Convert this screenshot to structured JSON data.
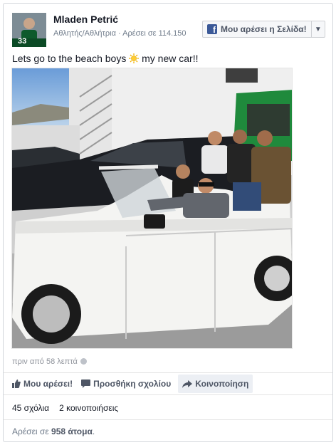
{
  "post": {
    "author": "Mladen Petrić",
    "category": "Αθλητής/Αθλήτρια",
    "likes_label": "Αρέσει σε 114.150",
    "avatar_number": "33",
    "text_before": "Lets go to the beach boys ",
    "text_after": " my new car!!",
    "emoji_icon": "sun-emoji-icon",
    "timestamp": "πριν από 58 λεπτά"
  },
  "like_page_button": {
    "label": "Μου αρέσει η Σελίδα!",
    "icon": "facebook-f-icon"
  },
  "actions": {
    "like": "Μου αρέσει!",
    "comment": "Προσθήκη σχολίου",
    "share": "Κοινοποίηση"
  },
  "stats": {
    "comments": "45 σχόλια",
    "shares": "2 κοινοποιήσεις"
  },
  "likes_summary": {
    "prefix": "Αρέσει σε ",
    "count": "958 άτομα",
    "suffix": "."
  },
  "colors": {
    "brand": "#3b5998",
    "action_text": "#4e5665",
    "meta": "#6f7b8a"
  }
}
